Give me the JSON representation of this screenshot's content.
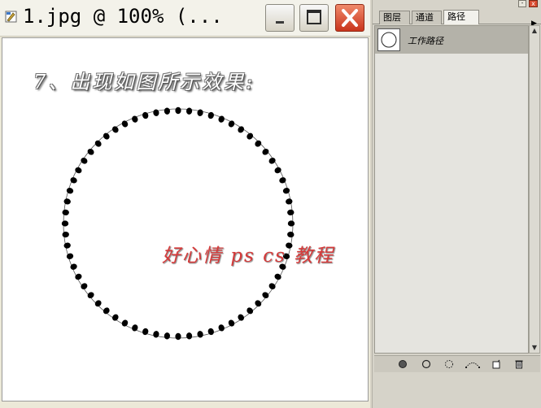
{
  "window": {
    "title": "1.jpg @ 100% (...",
    "minimize_glyph": "_",
    "maximize_glyph": "□",
    "close_glyph": "✕",
    "close_color": "#d4411f"
  },
  "canvas": {
    "step_text": "7、出现如图所示效果:",
    "watermark": "好心情 ps cs 教程",
    "watermark_color": "#d63a3a",
    "dot_color": "#000000",
    "dot_count": 64
  },
  "palette": {
    "tabs": [
      {
        "label": "图层",
        "active": false
      },
      {
        "label": "通道",
        "active": false
      },
      {
        "label": "路径",
        "active": true
      }
    ],
    "menu_glyph": "▶",
    "minimize_glyph": "-",
    "close_glyph": "x",
    "paths": [
      {
        "name": "工作路径",
        "thumbnail_icon": "circle-path-icon"
      }
    ],
    "footer_icons": [
      "fill-path-icon",
      "stroke-path-icon",
      "load-as-selection-icon",
      "make-work-path-icon",
      "new-path-icon",
      "delete-path-icon"
    ]
  }
}
